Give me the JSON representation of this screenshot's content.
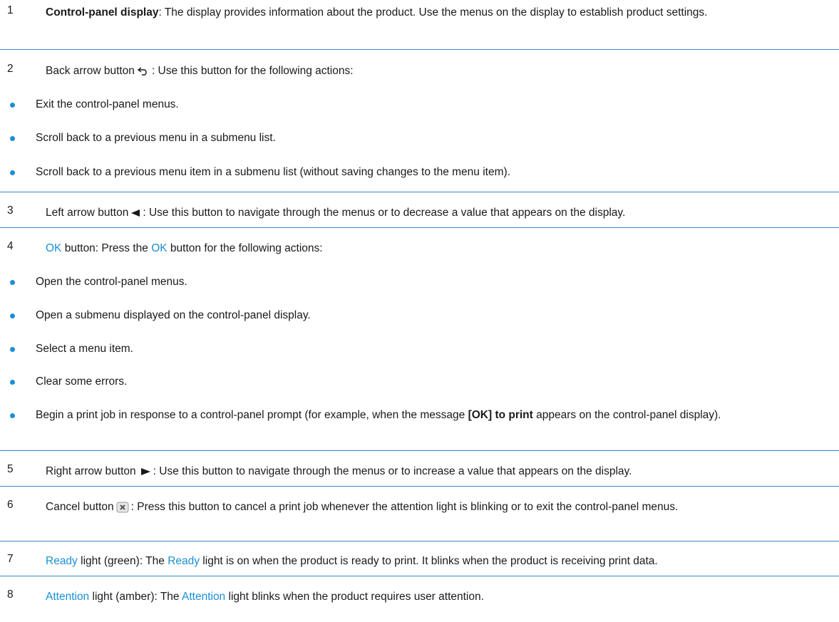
{
  "items": [
    {
      "num": "1",
      "bold": "Control-panel display",
      "rest": ": The display provides information about the product. Use the menus on the display to establish product settings."
    },
    {
      "num": "2",
      "text1": "Back arrow button",
      "icon": "back-arrow-icon",
      "text2": ": Use this button for the following actions:",
      "bullets": [
        "Exit the control-panel menus.",
        "Scroll back to a previous menu in a submenu list.",
        "Scroll back to a previous menu item in a submenu list (without saving changes to the menu item)."
      ]
    },
    {
      "num": "3",
      "text1": "Left arrow button",
      "icon": "left-arrow-icon",
      "text2": ": Use this button to navigate through the menus or to decrease a value that appears on the display."
    },
    {
      "num": "4",
      "kw1": "OK",
      "text1": " button: Press the ",
      "kw2": "OK",
      "text2": " button for the following actions:",
      "bullets": [
        "Open the control-panel menus.",
        "Open a submenu displayed on the control-panel display.",
        "Select a menu item.",
        "Clear some errors."
      ],
      "last_bullet": {
        "pre": "Begin a print job in response to a control-panel prompt (for example, when the message ",
        "bold": "[OK] to print",
        "post": " appears on the control-panel display)."
      }
    },
    {
      "num": "5",
      "text1": "Right arrow button",
      "icon": "right-arrow-icon",
      "text2": ": Use this button to navigate through the menus or to increase a value that appears on the display."
    },
    {
      "num": "6",
      "text1": "Cancel button",
      "icon": "cancel-icon",
      "text2": ": Press this button to cancel a print job whenever the attention light is blinking or to exit the control-panel menus."
    },
    {
      "num": "7",
      "kw1": "Ready",
      "text1": " light (green): The ",
      "kw2": "Ready",
      "text2": " light is on when the product is ready to print. It blinks when the product is receiving print data."
    },
    {
      "num": "8",
      "kw1": "Attention",
      "text1": " light (amber): The ",
      "kw2": "Attention",
      "text2": " light blinks when the product requires user attention."
    }
  ],
  "colors": {
    "accent": "#1a8fd6",
    "rule": "#3e82c8",
    "text": "#1a1a1a"
  }
}
